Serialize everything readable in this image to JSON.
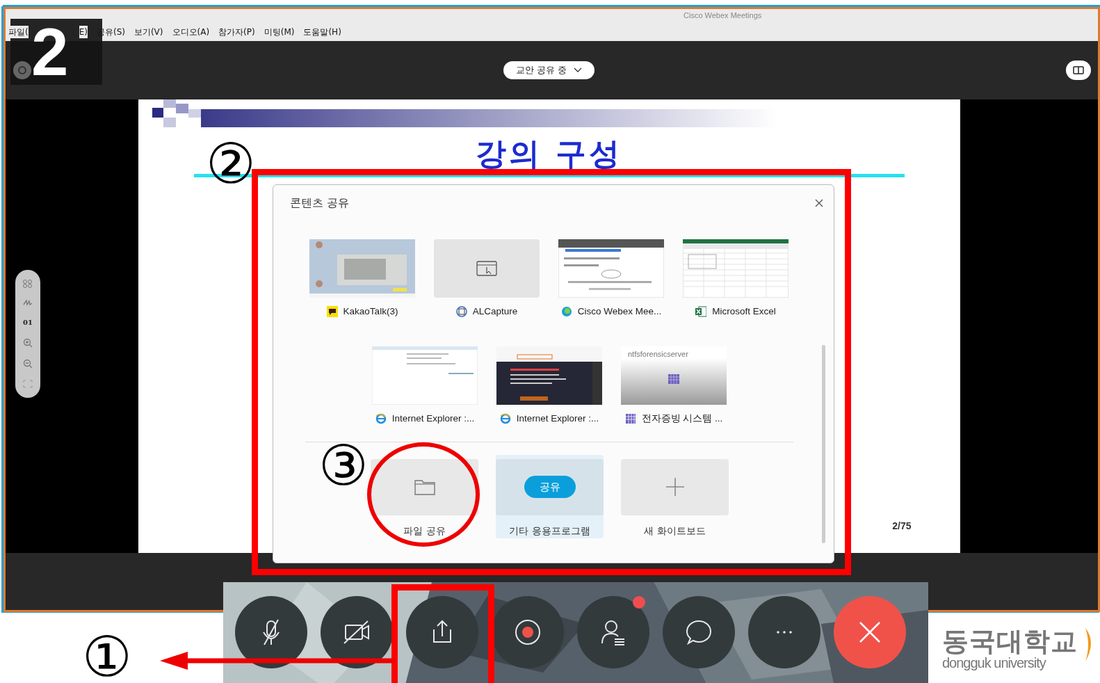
{
  "window": {
    "title": "Cisco Webex Meetings"
  },
  "menu": [
    {
      "label": "파일("
    },
    {
      "label": "E)"
    },
    {
      "label": "공유(S)"
    },
    {
      "label": "보기(V)"
    },
    {
      "label": "오디오(A)"
    },
    {
      "label": "참가자(P)"
    },
    {
      "label": "미팅(M)"
    },
    {
      "label": "도움말(H)"
    }
  ],
  "share_status": {
    "label": "교안 공유 중"
  },
  "slide": {
    "title": "강의 구성",
    "page": "2/75"
  },
  "annotation_toolbar": {
    "page": "01"
  },
  "dialog": {
    "title": "콘텐츠 공유",
    "windows": [
      {
        "label": "KakaoTalk(3)",
        "kind": "kakaotalk"
      },
      {
        "label": "ALCapture",
        "kind": "alcapture"
      },
      {
        "label": "Cisco Webex Mee...",
        "kind": "webex"
      },
      {
        "label": "Microsoft Excel",
        "kind": "excel"
      },
      {
        "label": "Internet Explorer :...",
        "kind": "ie-blank"
      },
      {
        "label": "Internet Explorer :...",
        "kind": "ie-dark"
      },
      {
        "label": "전자증빙 시스템 ...",
        "kind": "server",
        "caption": "ntfsforensicserver"
      }
    ],
    "options": [
      {
        "label": "파일 공유",
        "kind": "file",
        "selected": false
      },
      {
        "label": "기타 응용프로그램",
        "kind": "application",
        "selected": true,
        "button": "공유"
      },
      {
        "label": "새 화이트보드",
        "kind": "whiteboard",
        "selected": false
      }
    ]
  },
  "controls": [
    {
      "kind": "microphone-muted",
      "notification": false
    },
    {
      "kind": "camera-off",
      "notification": false
    },
    {
      "kind": "share",
      "notification": false
    },
    {
      "kind": "record",
      "notification": false
    },
    {
      "kind": "participants",
      "notification": true
    },
    {
      "kind": "chat",
      "notification": false
    },
    {
      "kind": "more",
      "notification": false
    },
    {
      "kind": "end",
      "notification": false
    }
  ],
  "callouts": {
    "step_badge": "2",
    "markers": [
      "①",
      "②",
      "③"
    ]
  },
  "logo": {
    "name": "동국대학교",
    "subtitle": "dongguk university"
  }
}
